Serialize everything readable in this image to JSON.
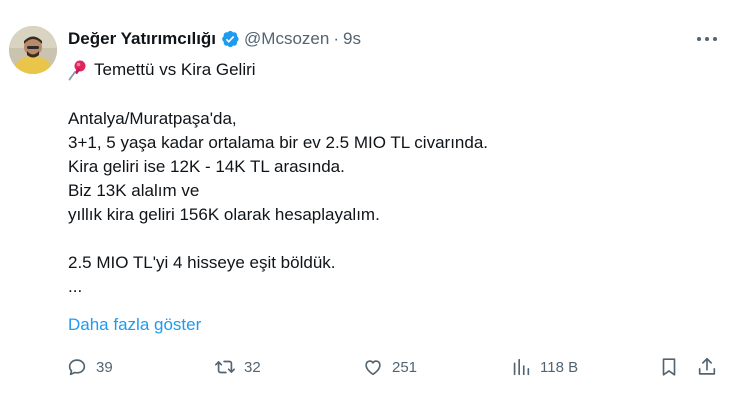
{
  "author": {
    "display_name": "Değer Yatırımcılığı",
    "handle": "@Mcsozen",
    "separator": "·",
    "time": "9s",
    "verified_icon": "verified-badge-icon",
    "verified_color": "#1d9bf0"
  },
  "subtitle": {
    "icon": "pushpin-icon",
    "text": "Temettü vs Kira Geliri"
  },
  "body": {
    "lines": [
      "Antalya/Muratpaşa'da,",
      "3+1, 5 yaşa kadar ortalama bir ev 2.5 MIO TL civarında.",
      "Kira geliri ise 12K - 14K TL arasında.",
      "Biz 13K alalım ve",
      "yıllık kira geliri 156K olarak hesaplayalım.",
      "",
      "2.5 MIO TL'yi 4 hisseye eşit böldük.",
      "..."
    ]
  },
  "show_more": "Daha fazla göster",
  "actions": {
    "reply_count": "39",
    "retweet_count": "32",
    "like_count": "251",
    "views_count": "118 B"
  },
  "colors": {
    "text": "#0f1419",
    "muted": "#536471",
    "link": "#1d9bf0"
  }
}
